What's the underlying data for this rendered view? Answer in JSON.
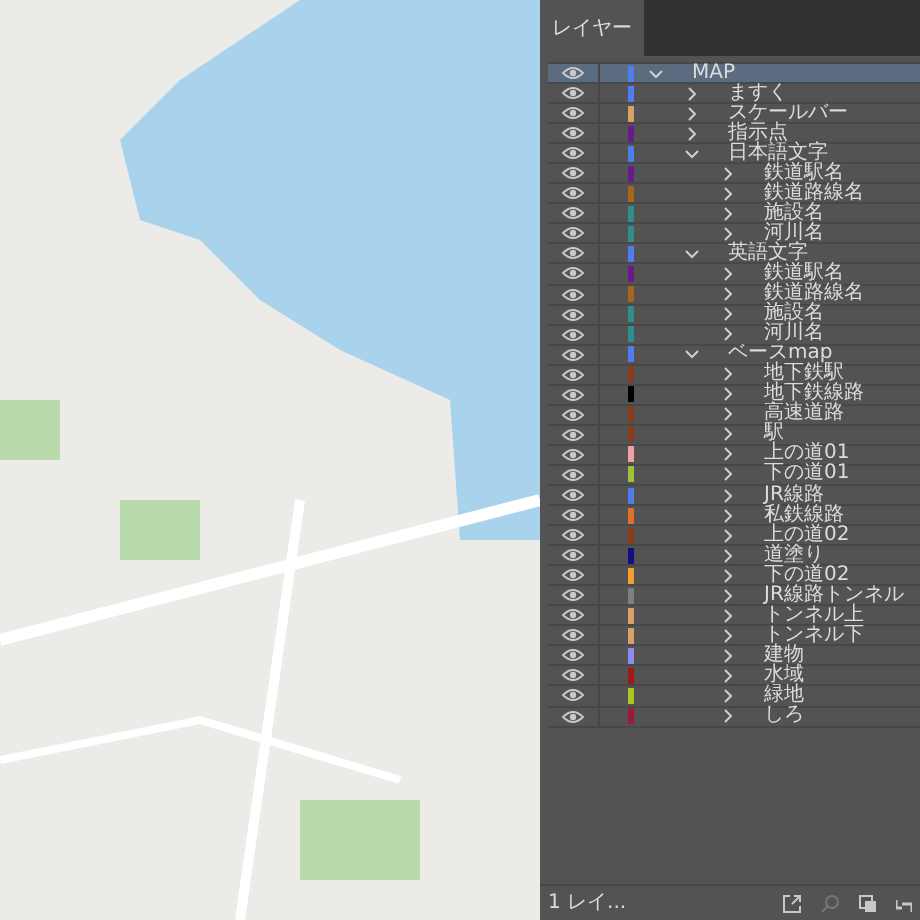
{
  "panel": {
    "tab": "レイヤー",
    "footer_count": "1 レイ..."
  },
  "layers": [
    {
      "name": "MAP",
      "color": "#4f7df0",
      "expanded": true,
      "selected": true,
      "children": [
        {
          "name": "ますく",
          "color": "#4f7df0",
          "expanded": false,
          "selected": false
        },
        {
          "name": "スケールバー",
          "color": "#d9a06a",
          "expanded": false,
          "selected": false
        },
        {
          "name": "指示点",
          "color": "#6a1b8a",
          "expanded": false,
          "selected": false
        },
        {
          "name": "日本語文字",
          "color": "#4f7df0",
          "expanded": true,
          "selected": false,
          "children": [
            {
              "name": "鉄道駅名",
              "color": "#6a1b8a",
              "expanded": false,
              "selected": false
            },
            {
              "name": "鉄道路線名",
              "color": "#a8651c",
              "expanded": false,
              "selected": false
            },
            {
              "name": "施設名",
              "color": "#2e8f8f",
              "expanded": false,
              "selected": false
            },
            {
              "name": "河川名",
              "color": "#2e8f8f",
              "expanded": false,
              "selected": false
            }
          ]
        },
        {
          "name": "英語文字",
          "color": "#4f7df0",
          "expanded": true,
          "selected": false,
          "children": [
            {
              "name": "鉄道駅名",
              "color": "#6a1b8a",
              "expanded": false,
              "selected": false
            },
            {
              "name": "鉄道路線名",
              "color": "#a8651c",
              "expanded": false,
              "selected": false
            },
            {
              "name": "施設名",
              "color": "#2e8f8f",
              "expanded": false,
              "selected": false
            },
            {
              "name": "河川名",
              "color": "#2e8f8f",
              "expanded": false,
              "selected": false
            }
          ]
        },
        {
          "name": "ベースmap",
          "color": "#4f7df0",
          "expanded": true,
          "selected": false,
          "children": [
            {
              "name": "地下鉄駅",
              "color": "#8b3a1c",
              "expanded": false,
              "selected": false
            },
            {
              "name": "地下鉄線路",
              "color": "#000000",
              "expanded": false,
              "selected": false
            },
            {
              "name": "高速道路",
              "color": "#8b3a1c",
              "expanded": false,
              "selected": false
            },
            {
              "name": "駅",
              "color": "#8b3a1c",
              "expanded": false,
              "selected": false
            },
            {
              "name": "上の道01",
              "color": "#f0a0a0",
              "expanded": false,
              "selected": false
            },
            {
              "name": "下の道01",
              "color": "#9cc43a",
              "expanded": false,
              "selected": false
            },
            {
              "name": "JR線路",
              "color": "#4f7df0",
              "expanded": false,
              "selected": false
            },
            {
              "name": "私鉄線路",
              "color": "#e0702a",
              "expanded": false,
              "selected": false
            },
            {
              "name": "上の道02",
              "color": "#8b3a1c",
              "expanded": false,
              "selected": false
            },
            {
              "name": "道塗り",
              "color": "#101080",
              "expanded": false,
              "selected": false
            },
            {
              "name": "下の道02",
              "color": "#f0a030",
              "expanded": false,
              "selected": false
            },
            {
              "name": "JR線路トンネル",
              "color": "#808080",
              "expanded": false,
              "selected": false
            },
            {
              "name": "トンネル上",
              "color": "#d9a06a",
              "expanded": false,
              "selected": false
            },
            {
              "name": "トンネル下",
              "color": "#d9a06a",
              "expanded": false,
              "selected": false
            },
            {
              "name": "建物",
              "color": "#8c8cf0",
              "expanded": false,
              "selected": false
            },
            {
              "name": "水域",
              "color": "#a01818",
              "expanded": false,
              "selected": false
            },
            {
              "name": "緑地",
              "color": "#a8c820",
              "expanded": false,
              "selected": false
            },
            {
              "name": "しろ",
              "color": "#a01838",
              "expanded": false,
              "selected": false
            }
          ]
        }
      ]
    }
  ]
}
